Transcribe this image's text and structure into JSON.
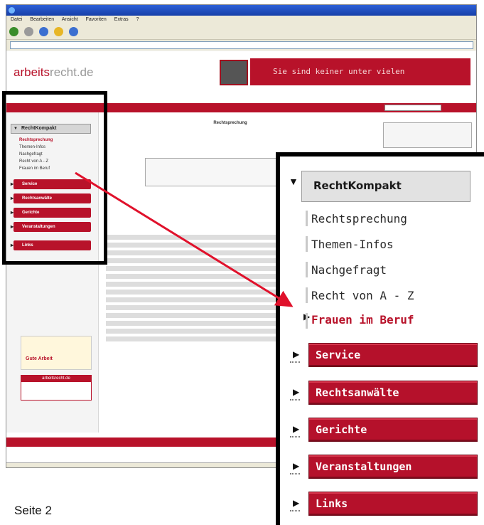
{
  "zoom": {
    "heading": "RechtKompakt",
    "subitems": [
      {
        "label": "Rechtsprechung"
      },
      {
        "label": "Themen-Infos"
      },
      {
        "label": "Nachgefragt"
      },
      {
        "label": "Recht von A - Z"
      },
      {
        "label": "Frauen im Beruf"
      }
    ],
    "buttons": [
      {
        "label": "Service"
      },
      {
        "label": "Rechtsanwälte"
      },
      {
        "label": "Gerichte"
      },
      {
        "label": "Veranstaltungen"
      },
      {
        "label": "Links"
      }
    ]
  },
  "browser": {
    "menubar": [
      "Datei",
      "Bearbeiten",
      "Ansicht",
      "Favoriten",
      "Extras",
      "?"
    ],
    "banner_text": "Sie sind keiner unter vielen",
    "logo_prefix": "arbeits",
    "logo_suffix": "recht.de",
    "small_menu": {
      "heading": "RechtKompakt",
      "subitems": [
        "Rechtsprechung",
        "Themen-Infos",
        "Nachgefragt",
        "Recht von A - Z",
        "Frauen im Beruf"
      ],
      "buttons": [
        "Service",
        "Rechtsanwälte",
        "Gerichte",
        "Veranstaltungen",
        "Links"
      ]
    },
    "main_title": "Rechtsprechung",
    "sidebox_header": "arbeitsrecht.de",
    "sidebox_image_caption": "Gute Arbeit"
  },
  "page_label": "Seite 2",
  "colors": {
    "accent_red": "#b8122a",
    "active_text": "#b8122a",
    "highlight_border": "#000000",
    "connector_arrow": "#e0112b"
  }
}
